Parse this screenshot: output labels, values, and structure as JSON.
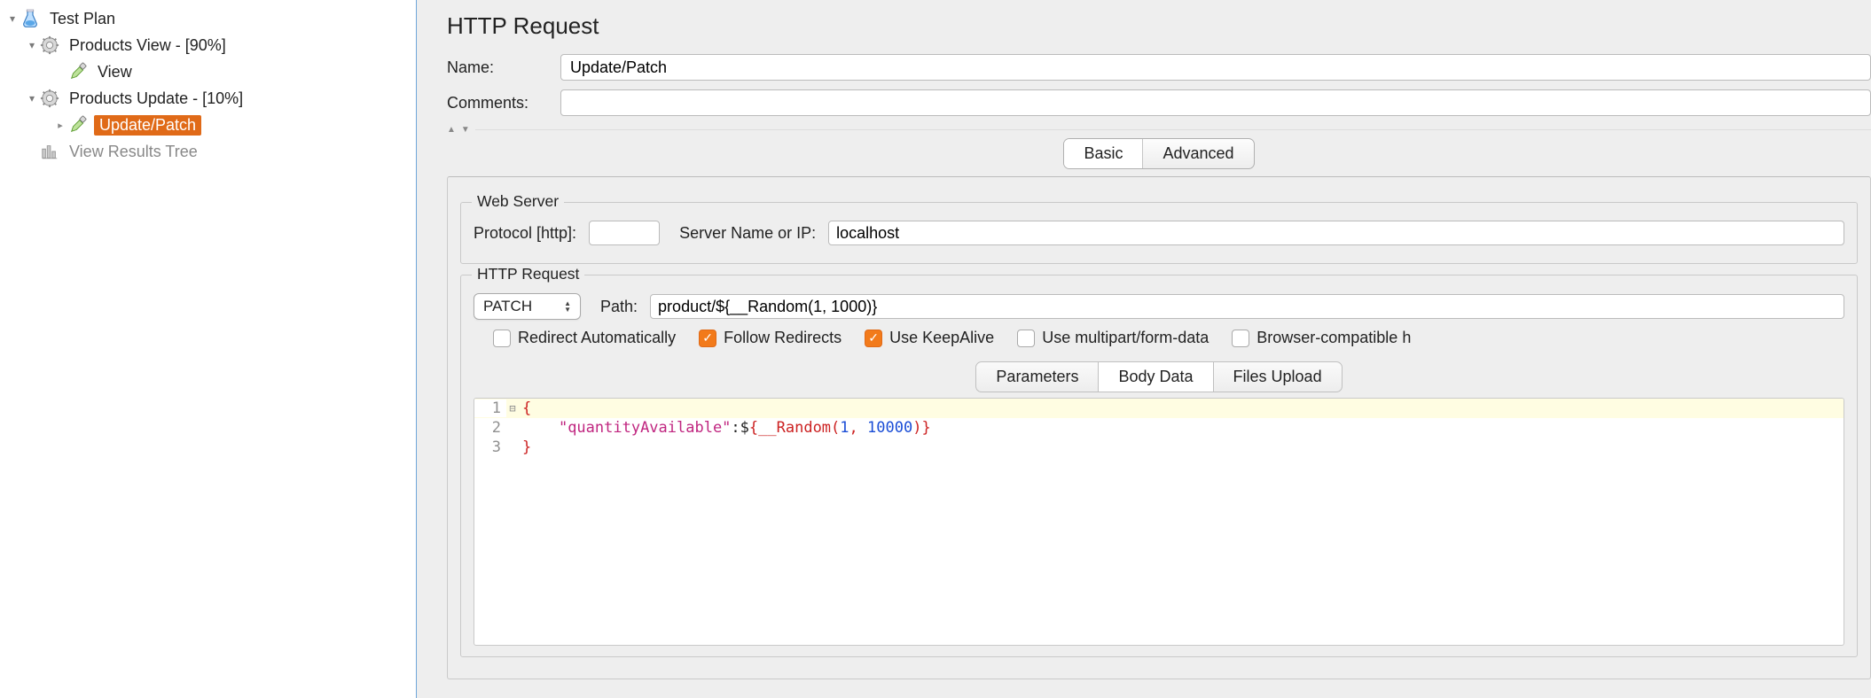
{
  "tree": {
    "root": "Test Plan",
    "group1": "Products View - [90%]",
    "group1_child": "View",
    "group2": "Products Update - [10%]",
    "group2_child": "Update/Patch",
    "results": "View Results Tree"
  },
  "header": {
    "title": "HTTP Request",
    "name_label": "Name:",
    "name_value": "Update/Patch",
    "comments_label": "Comments:",
    "comments_value": ""
  },
  "view_tabs": {
    "basic": "Basic",
    "advanced": "Advanced"
  },
  "web_server": {
    "legend": "Web Server",
    "protocol_label": "Protocol [http]:",
    "protocol_value": "",
    "server_label": "Server Name or IP:",
    "server_value": "localhost"
  },
  "http_request": {
    "legend": "HTTP Request",
    "method": "PATCH",
    "path_label": "Path:",
    "path_value": "product/${__Random(1, 1000)}"
  },
  "checkboxes": {
    "redirect_auto": {
      "label": "Redirect Automatically",
      "checked": false
    },
    "follow_redirects": {
      "label": "Follow Redirects",
      "checked": true
    },
    "keepalive": {
      "label": "Use KeepAlive",
      "checked": true
    },
    "multipart": {
      "label": "Use multipart/form-data",
      "checked": false
    },
    "browser_compat": {
      "label": "Browser-compatible h",
      "checked": false
    }
  },
  "body_tabs": {
    "parameters": "Parameters",
    "body_data": "Body Data",
    "files_upload": "Files Upload"
  },
  "editor": {
    "line1": "{",
    "line2_key": "\"quantityAvailable\"",
    "line2_sep": ":",
    "line2_dollar": "$",
    "line2_func_open": "{__Random(",
    "line2_arg1": "1",
    "line2_comma": ", ",
    "line2_arg2": "10000",
    "line2_func_close": ")}",
    "line3": "}",
    "ln1": "1",
    "ln2": "2",
    "ln3": "3"
  }
}
